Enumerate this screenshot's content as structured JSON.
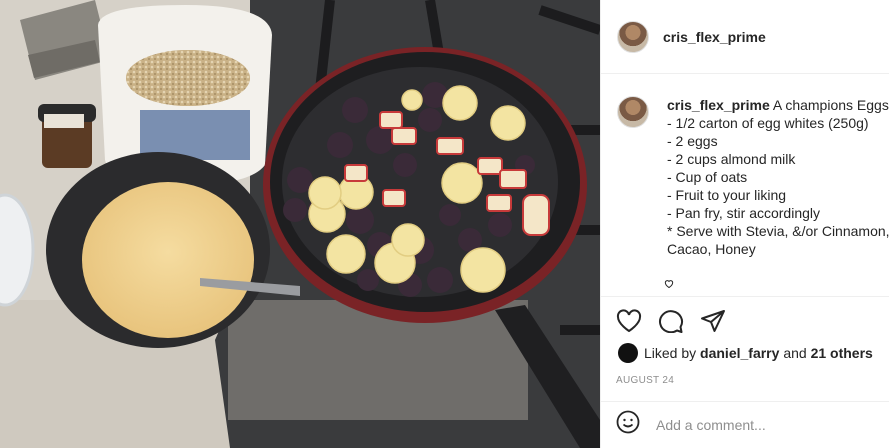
{
  "post": {
    "username": "cris_flex_prime",
    "caption_lines": [
      "A champions Eggs!",
      "- 1/2 carton of egg whites (250g)",
      "- 2 eggs",
      "- 2 cups almond milk",
      "- Cup of oats",
      "- Fruit to your liking",
      "- Pan fry, stir accordingly",
      "* Serve with Stevia, &/or Cinnamon,",
      "Cacao, Honey"
    ],
    "liked_by_prefix": "Liked by",
    "liked_by_user": "daniel_farry",
    "liked_by_and": "and",
    "liked_by_others": "21 others",
    "date": "AUGUST 24",
    "comment_placeholder": "Add a comment..."
  },
  "icons": {
    "like": "heart-outline-icon",
    "comment": "speech-bubble-icon",
    "share": "paper-plane-icon",
    "emoji": "smiley-icon",
    "caption_like": "heart-small-icon"
  },
  "colors": {
    "text": "#262626",
    "muted": "#8e8e8e",
    "border": "#efefef"
  }
}
